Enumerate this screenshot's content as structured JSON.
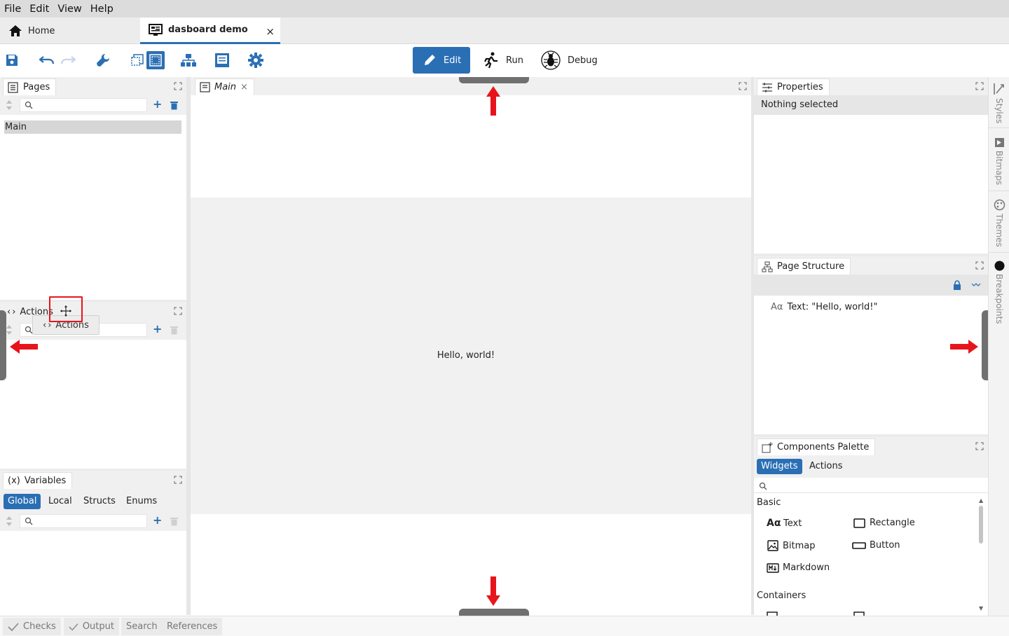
{
  "menu": [
    "File",
    "Edit",
    "View",
    "Help"
  ],
  "tabs": {
    "home": "Home",
    "document": "dasboard demo",
    "close": "×"
  },
  "modes": {
    "edit": "Edit",
    "run": "Run",
    "debug": "Debug"
  },
  "colors": {
    "accent": "#2a6fb4",
    "arrow": "#e8141b",
    "drop_highlight": "#e8141b"
  },
  "pages_panel": {
    "title": "Pages",
    "items": [
      "Main"
    ]
  },
  "actions_panel": {
    "title": "Actions",
    "drag_ghost": "Actions"
  },
  "variables_panel": {
    "title": "Variables",
    "subtabs": [
      "Global",
      "Local",
      "Structs",
      "Enums"
    ],
    "active_subtab": "Global"
  },
  "editor": {
    "tab": "Main",
    "canvas_text": "Hello, world!"
  },
  "properties_panel": {
    "title": "Properties",
    "status": "Nothing selected"
  },
  "page_structure_panel": {
    "title": "Page Structure",
    "items": [
      {
        "icon": "text-widget-icon",
        "label": "Text: \"Hello, world!\""
      }
    ]
  },
  "components_palette": {
    "title": "Components Palette",
    "tabs": [
      "Widgets",
      "Actions"
    ],
    "active_tab": "Widgets",
    "groups": [
      {
        "name": "Basic",
        "items": [
          "Text",
          "Rectangle",
          "Bitmap",
          "Button",
          "Markdown"
        ]
      },
      {
        "name": "Containers",
        "items": []
      }
    ]
  },
  "right_sidebar": [
    "Styles",
    "Bitmaps",
    "Themes",
    "Breakpoints"
  ],
  "bottom_tabs": [
    "Checks",
    "Output",
    "Search",
    "References"
  ]
}
